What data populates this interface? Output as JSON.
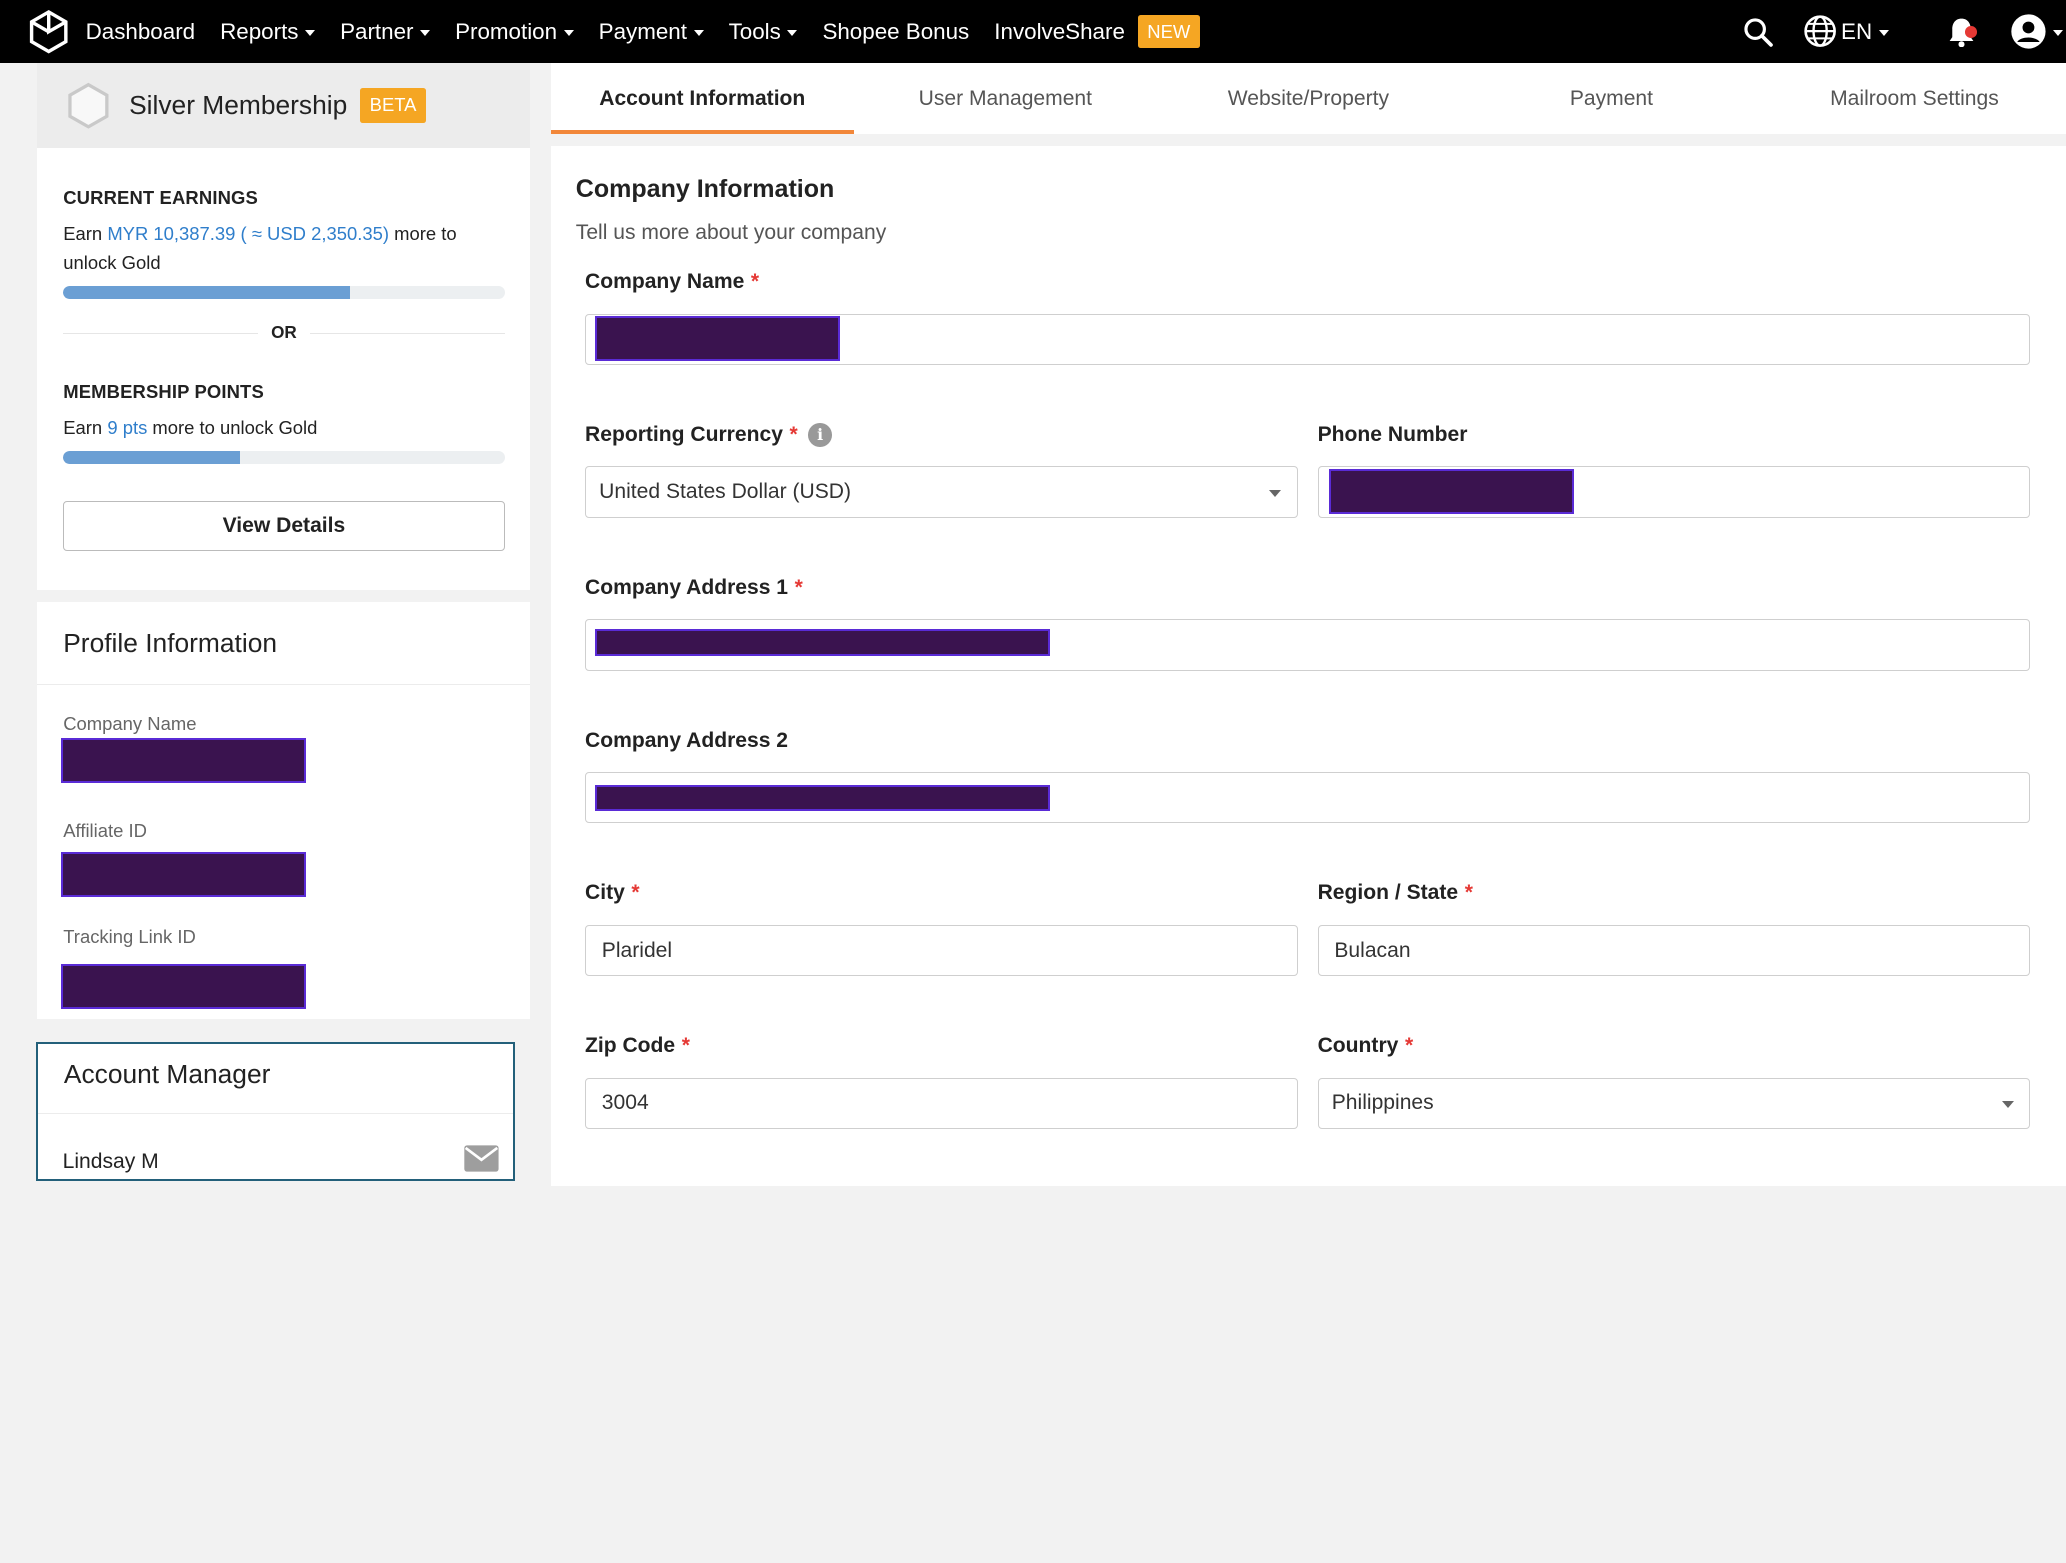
{
  "nav": {
    "items": [
      {
        "label": "Dashboard",
        "dropdown": false
      },
      {
        "label": "Reports",
        "dropdown": true
      },
      {
        "label": "Partner",
        "dropdown": true
      },
      {
        "label": "Promotion",
        "dropdown": true
      },
      {
        "label": "Payment",
        "dropdown": true
      },
      {
        "label": "Tools",
        "dropdown": true
      },
      {
        "label": "Shopee Bonus",
        "dropdown": false
      },
      {
        "label": "InvolveShare",
        "dropdown": false
      }
    ],
    "new_badge": "NEW",
    "language": "EN"
  },
  "membership": {
    "title": "Silver Membership",
    "badge": "BETA",
    "earnings_heading": "CURRENT EARNINGS",
    "earn_prefix": "Earn ",
    "earn_amount": "MYR 10,387.39 ( ≈ USD 2,350.35)",
    "earn_suffix": " more to unlock Gold",
    "earnings_progress": 0.65,
    "or_label": "OR",
    "points_heading": "MEMBERSHIP POINTS",
    "points_prefix": "Earn ",
    "points_amount": "9 pts",
    "points_suffix": " more to unlock Gold",
    "points_progress": 0.4,
    "details_button": "View Details"
  },
  "profile": {
    "title": "Profile Information",
    "fields": [
      "Company Name",
      "Affiliate ID",
      "Tracking Link ID"
    ]
  },
  "manager": {
    "title": "Account Manager",
    "name": "Lindsay M"
  },
  "tabs": [
    "Account Information",
    "User Management",
    "Website/Property",
    "Payment",
    "Mailroom Settings"
  ],
  "form": {
    "title": "Company Information",
    "subtitle": "Tell us more about your company",
    "company_name_label": "Company Name",
    "currency_label": "Reporting Currency",
    "currency_value": "United States Dollar (USD)",
    "phone_label": "Phone Number",
    "address1_label": "Company Address 1",
    "address2_label": "Company Address 2",
    "city_label": "City",
    "city_value": "Plaridel",
    "region_label": "Region / State",
    "region_value": "Bulacan",
    "zip_label": "Zip Code",
    "zip_value": "3004",
    "country_label": "Country",
    "country_value": "Philippines",
    "required_mark": "*",
    "info_glyph": "i"
  },
  "colors": {
    "accent": "#f2873a",
    "link": "#2f7ecb",
    "badge": "#f5a623",
    "redaction": "#3a134f"
  }
}
